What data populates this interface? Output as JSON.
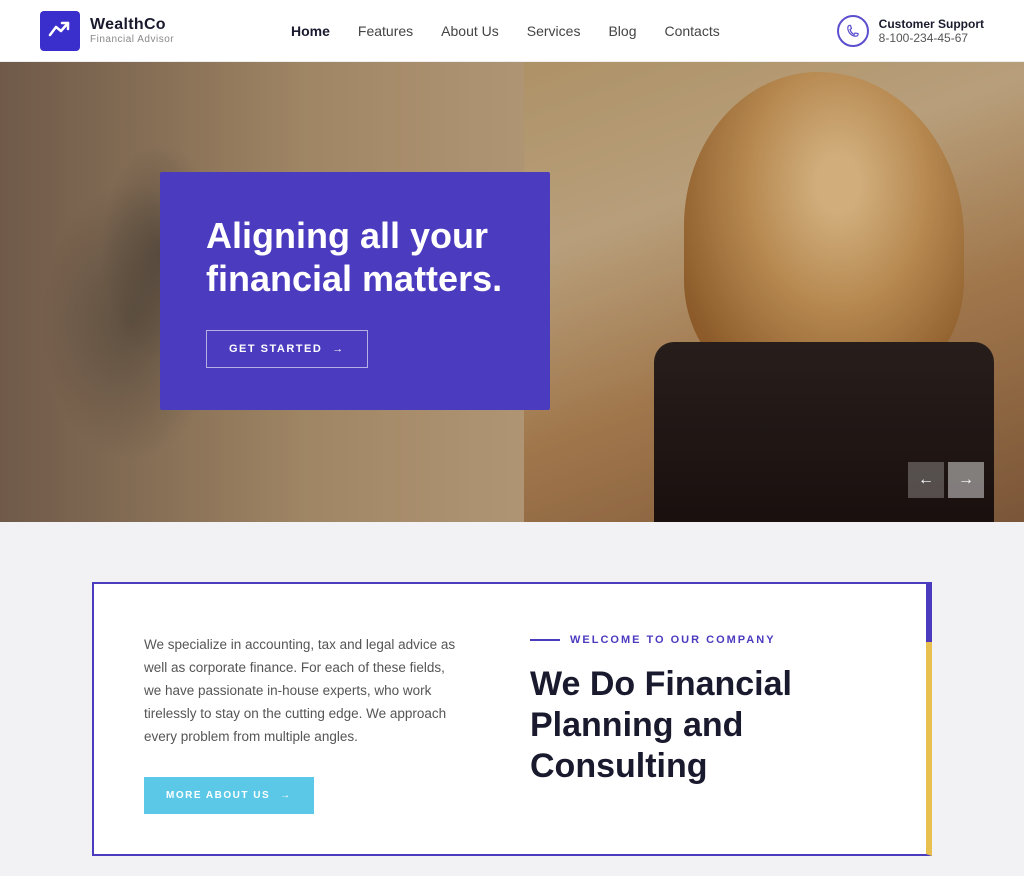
{
  "header": {
    "logo": {
      "company": "WealthCo",
      "tagline": "Financial Advisor"
    },
    "nav": {
      "items": [
        {
          "label": "Home",
          "active": true
        },
        {
          "label": "Features",
          "active": false
        },
        {
          "label": "About Us",
          "active": false
        },
        {
          "label": "Services",
          "active": false
        },
        {
          "label": "Blog",
          "active": false
        },
        {
          "label": "Contacts",
          "active": false
        }
      ]
    },
    "support": {
      "label": "Customer Support",
      "phone": "8-100-234-45-67"
    }
  },
  "hero": {
    "heading": "Aligning all your financial matters.",
    "cta_label": "GET STARTED",
    "arrow_left": "←",
    "arrow_right": "→"
  },
  "content": {
    "welcome_label": "WELCOME TO OUR COMPANY",
    "description": "We specialize in accounting, tax and legal advice as well as corporate finance. For each of these fields, we have passionate in-house experts, who work tirelessly to stay on the cutting edge. We approach every problem from multiple angles.",
    "more_btn": "MORE ABOUT US",
    "heading": "We Do Financial Planning and Consulting"
  }
}
